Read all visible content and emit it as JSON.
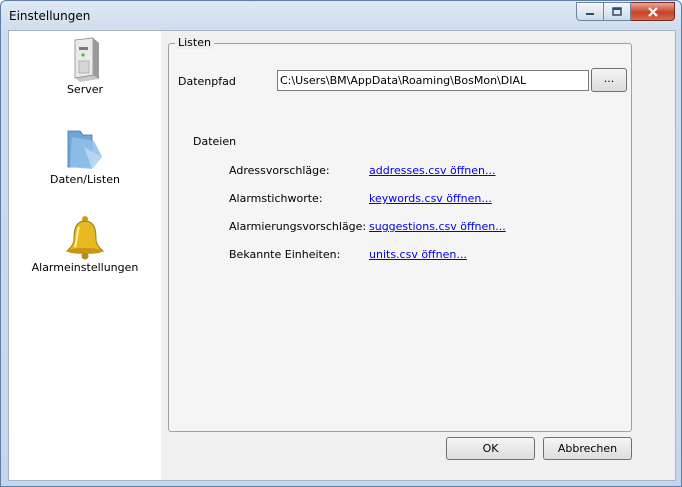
{
  "window": {
    "title": "Einstellungen"
  },
  "sidebar": {
    "items": [
      {
        "label": "Server",
        "icon": "server-icon"
      },
      {
        "label": "Daten/Listen",
        "icon": "folder-icon"
      },
      {
        "label": "Alarmeinstellungen",
        "icon": "bell-icon"
      }
    ]
  },
  "group": {
    "title": "Listen",
    "path_label": "Datenpfad",
    "path_value": "C:\\Users\\BM\\AppData\\Roaming\\BosMon\\DIAL",
    "browse_label": "...",
    "files_label": "Dateien",
    "rows": [
      {
        "label": "Adressvorschläge:",
        "link": "addresses.csv öffnen..."
      },
      {
        "label": "Alarmstichworte:",
        "link": "keywords.csv öffnen..."
      },
      {
        "label": "Alarmierungsvorschläge:",
        "link": "suggestions.csv öffnen..."
      },
      {
        "label": "Bekannte Einheiten:",
        "link": "units.csv öffnen..."
      }
    ]
  },
  "buttons": {
    "ok": "OK",
    "cancel": "Abbrechen"
  }
}
